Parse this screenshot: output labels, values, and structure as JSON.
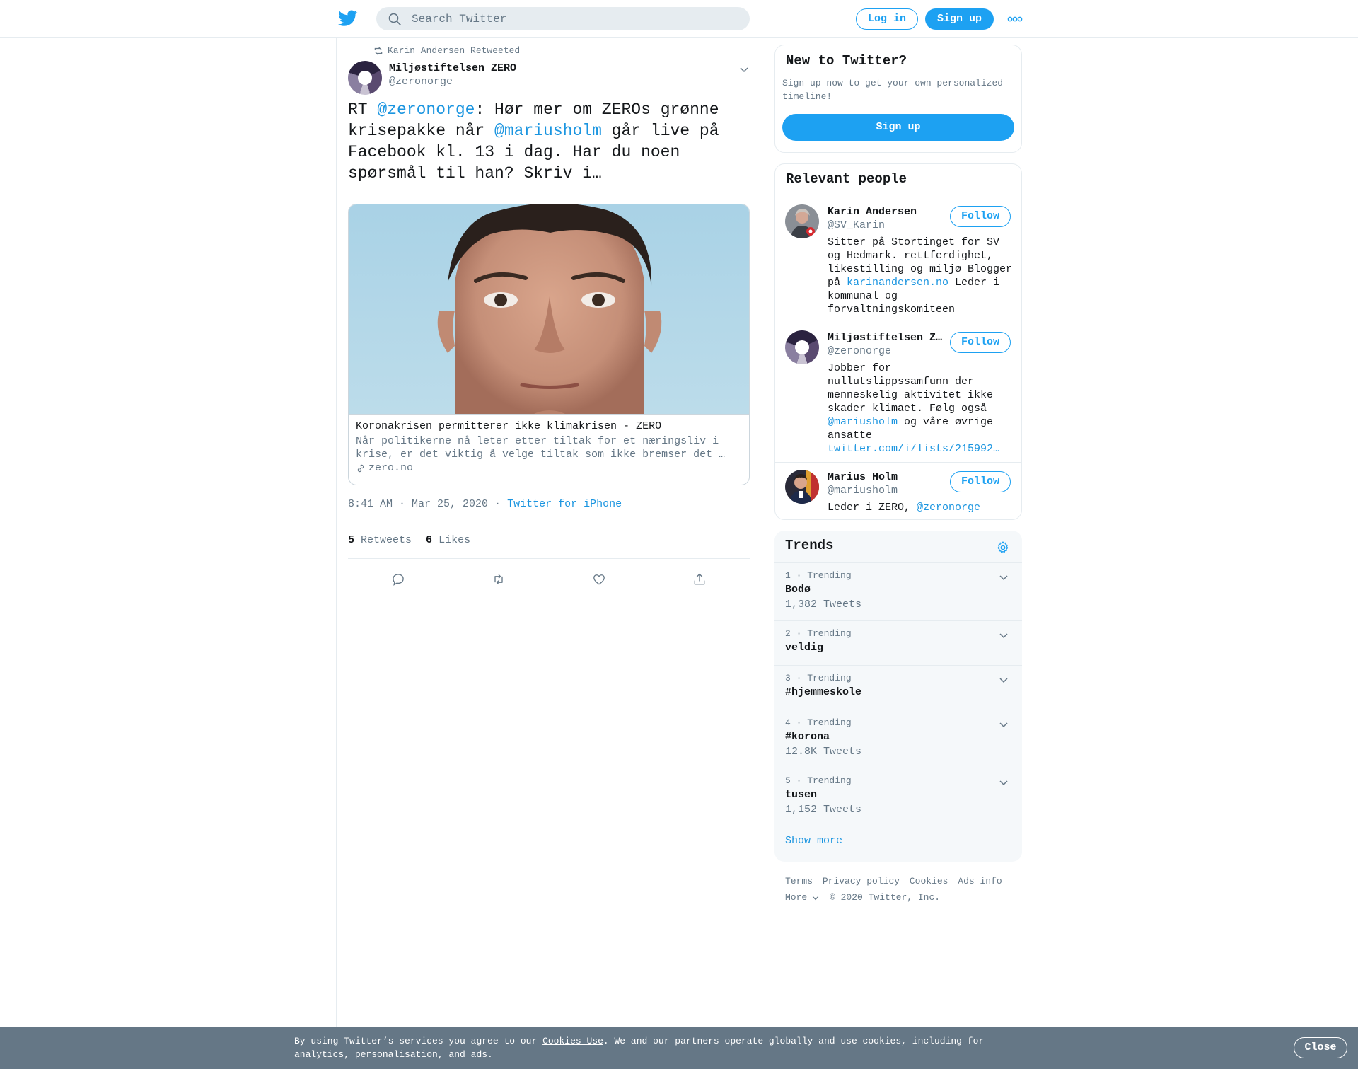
{
  "header": {
    "search_placeholder": "Search Twitter",
    "login_label": "Log in",
    "signup_label": "Sign up"
  },
  "tweet": {
    "retweet_context": "Karin Andersen Retweeted",
    "author_name": "Miljøstiftelsen ZERO",
    "author_handle": "@zeronorge",
    "text_parts": {
      "p1": "RT ",
      "m1": "@zeronorge",
      "p2": ": Hør mer om ZEROs grønne krisepakke når ",
      "m2": "@mariusholm",
      "p3": " går live på Facebook kl. 13 i dag. Har du noen spørsmål til han? Skriv i…"
    },
    "card": {
      "title": "Koronakrisen permitterer ikke klimakrisen - ZERO",
      "description": "Når politikerne nå leter etter tiltak for et næringsliv i krise, er det viktig å velge tiltak som ikke bremser det …",
      "domain": "zero.no"
    },
    "time": "8:41 AM · Mar 25, 2020",
    "meta_sep": " · ",
    "source": "Twitter for iPhone",
    "retweets_count": "5",
    "retweets_label": "Retweets",
    "likes_count": "6",
    "likes_label": "Likes"
  },
  "new_to_twitter": {
    "title": "New to Twitter?",
    "subtitle": "Sign up now to get your own personalized timeline!",
    "signup_label": "Sign up"
  },
  "relevant_people": {
    "title": "Relevant people",
    "follow_label": "Follow",
    "people": [
      {
        "name": "Karin Andersen",
        "handle": "@SV_Karin",
        "bio_pre": "Sitter på Stortinget for SV og Hedmark. rettferdighet, likestilling og miljø Blogger på ",
        "bio_link": "karinandersen.no",
        "bio_post": " Leder i kommunal og forvaltningskomiteen"
      },
      {
        "name": "Miljøstiftelsen ZERO",
        "handle": "@zeronorge",
        "bio_pre": "Jobber for nullutslippssamfunn der menneskelig aktivitet ikke skader klimaet. Følg også ",
        "bio_link": "@mariusholm",
        "bio_mid": " og våre øvrige ansatte ",
        "bio_link2": "twitter.com/i/lists/215992…"
      },
      {
        "name": "Marius Holm",
        "handle": "@mariusholm",
        "bio_pre": "Leder i ZERO, ",
        "bio_link": "@zeronorge"
      }
    ]
  },
  "trends": {
    "title": "Trends",
    "items": [
      {
        "meta": "1 · Trending",
        "name": "Bodø",
        "count": "1,382 Tweets"
      },
      {
        "meta": "2 · Trending",
        "name": "veldig",
        "count": ""
      },
      {
        "meta": "3 · Trending",
        "name": "#hjemmeskole",
        "count": ""
      },
      {
        "meta": "4 · Trending",
        "name": "#korona",
        "count": "12.8K Tweets"
      },
      {
        "meta": "5 · Trending",
        "name": "tusen",
        "count": "1,152 Tweets"
      }
    ],
    "show_more": "Show more"
  },
  "footer": {
    "terms": "Terms",
    "privacy": "Privacy policy",
    "cookies": "Cookies",
    "ads": "Ads info",
    "more": "More",
    "copyright": "© 2020 Twitter, Inc."
  },
  "cookie_bar": {
    "text_pre": "By using Twitter’s services you agree to our ",
    "link": "Cookies Use",
    "text_post": ". We and our partners operate globally and use cookies, including for analytics, personalisation, and ads.",
    "close_label": "Close"
  },
  "colors": {
    "brand": "#1da1f2",
    "link": "#1b95e0",
    "secondary_text": "#657786",
    "cookie_bar": "#657786"
  }
}
